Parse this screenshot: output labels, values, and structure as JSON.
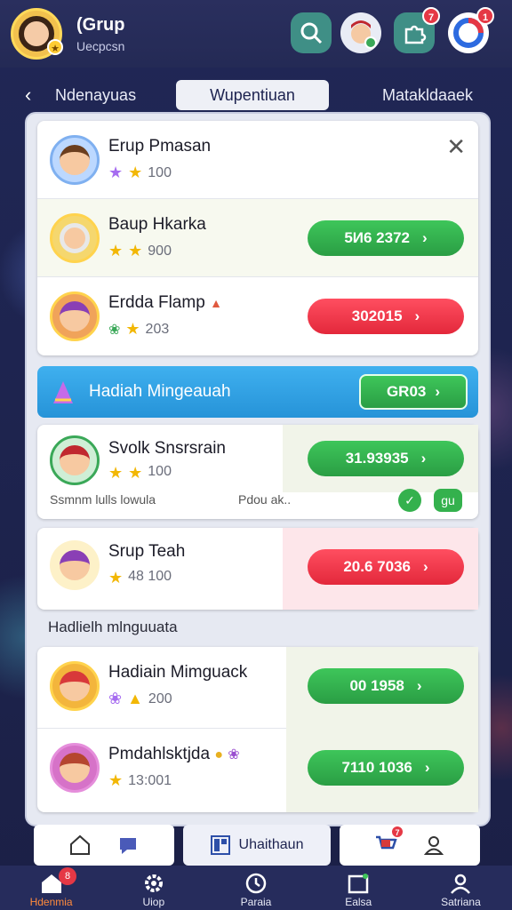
{
  "header": {
    "title": "(Grup",
    "subtitle": "Uecpcsn",
    "notif_friend": "",
    "notif_puzzle": "7",
    "notif_spin": "1"
  },
  "tabs": {
    "left": "Ndenayuas",
    "active": "Wupentiuan",
    "right": "Matakldaaek"
  },
  "top_card": {
    "rows": [
      {
        "name": "Erup Pmasan",
        "score": "100",
        "button": ""
      },
      {
        "name": "Baup Hkarka",
        "score": "900",
        "button": "5И6 2372"
      },
      {
        "name": "Erdda Flamp",
        "score": "203",
        "button": "302015"
      }
    ]
  },
  "banner": {
    "label": "Hadiah Mingeauah",
    "button": "GR03"
  },
  "card2": {
    "name": "Svolk Snsrsrain",
    "score": "100",
    "button": "31.93935",
    "footer_left": "Ssmnm lulls lowula",
    "footer_right": "Pdou ak..",
    "tag": "gu"
  },
  "card3": {
    "name": "Srup Teah",
    "score": "48 100",
    "button": "20.6 7036"
  },
  "section_title": "Hadlielh mlnguuata",
  "card4": {
    "rows": [
      {
        "name": "Hadiain Mimguack",
        "score": "200",
        "button": "00 1958"
      },
      {
        "name": "Pmdahlsktjda",
        "score": "13:001",
        "button": "7110 1036"
      }
    ]
  },
  "midbar": {
    "center_label": "Uhaithaun",
    "notif": "7"
  },
  "bottom_nav": [
    {
      "label": "Hdenmia",
      "icon": "home-icon",
      "notif": "8"
    },
    {
      "label": "Uiop",
      "icon": "gear-icon"
    },
    {
      "label": "Paraia",
      "icon": "clock-icon"
    },
    {
      "label": "Ealsa",
      "icon": "calendar-icon"
    },
    {
      "label": "Satriana",
      "icon": "user-icon"
    }
  ]
}
